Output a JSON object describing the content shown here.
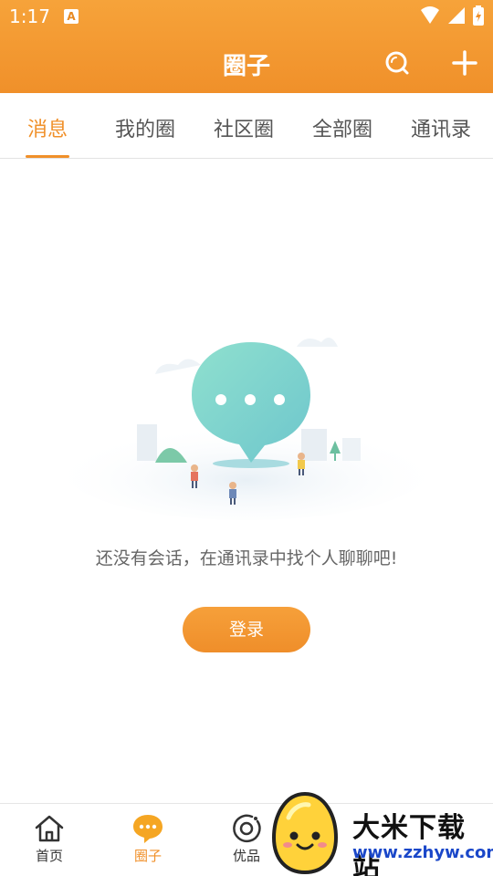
{
  "status_bar": {
    "time": "1:17",
    "app_badge": "A"
  },
  "header": {
    "title": "圈子",
    "icons": [
      "search-icon",
      "add-icon"
    ]
  },
  "tabs": [
    {
      "label": "消息",
      "active": true
    },
    {
      "label": "我的圈",
      "active": false
    },
    {
      "label": "社区圈",
      "active": false
    },
    {
      "label": "全部圈",
      "active": false
    },
    {
      "label": "通讯录",
      "active": false
    }
  ],
  "empty_state": {
    "message": "还没有会话，在通讯录中找个人聊聊吧!",
    "button": "登录"
  },
  "bottom_nav": [
    {
      "label": "首页",
      "icon": "home-icon",
      "active": false
    },
    {
      "label": "圈子",
      "icon": "chat-bubble-icon",
      "active": true
    },
    {
      "label": "优品",
      "icon": "target-icon",
      "active": false
    }
  ],
  "watermark": {
    "name": "大米下载站",
    "url": "www.zzhyw.com"
  },
  "colors": {
    "accent": "#f0902a",
    "header_top": "#f6a33a",
    "bubble": "#7dd3c9"
  }
}
